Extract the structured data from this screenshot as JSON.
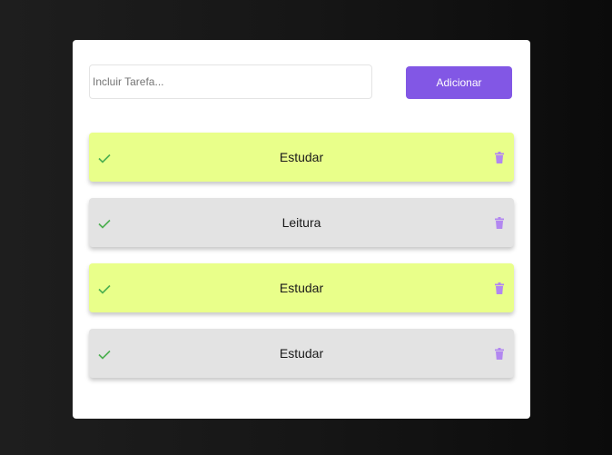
{
  "form": {
    "input_placeholder": "Incluir Tarefa...",
    "input_value": "",
    "add_button_label": "Adicionar"
  },
  "colors": {
    "accent": "#8257e5",
    "done_background": "#e9ff8a",
    "pending_background": "#e3e3e3",
    "check_icon": "#4caf50",
    "trash_icon": "#b287f0"
  },
  "tasks": [
    {
      "title": "Estudar",
      "status": "highlighted",
      "check_icon": "check-icon",
      "delete_icon": "trash-icon"
    },
    {
      "title": "Leitura",
      "status": "normal",
      "check_icon": "check-icon",
      "delete_icon": "trash-icon"
    },
    {
      "title": "Estudar",
      "status": "highlighted",
      "check_icon": "check-icon",
      "delete_icon": "trash-icon"
    },
    {
      "title": "Estudar",
      "status": "normal",
      "check_icon": "check-icon",
      "delete_icon": "trash-icon"
    }
  ]
}
